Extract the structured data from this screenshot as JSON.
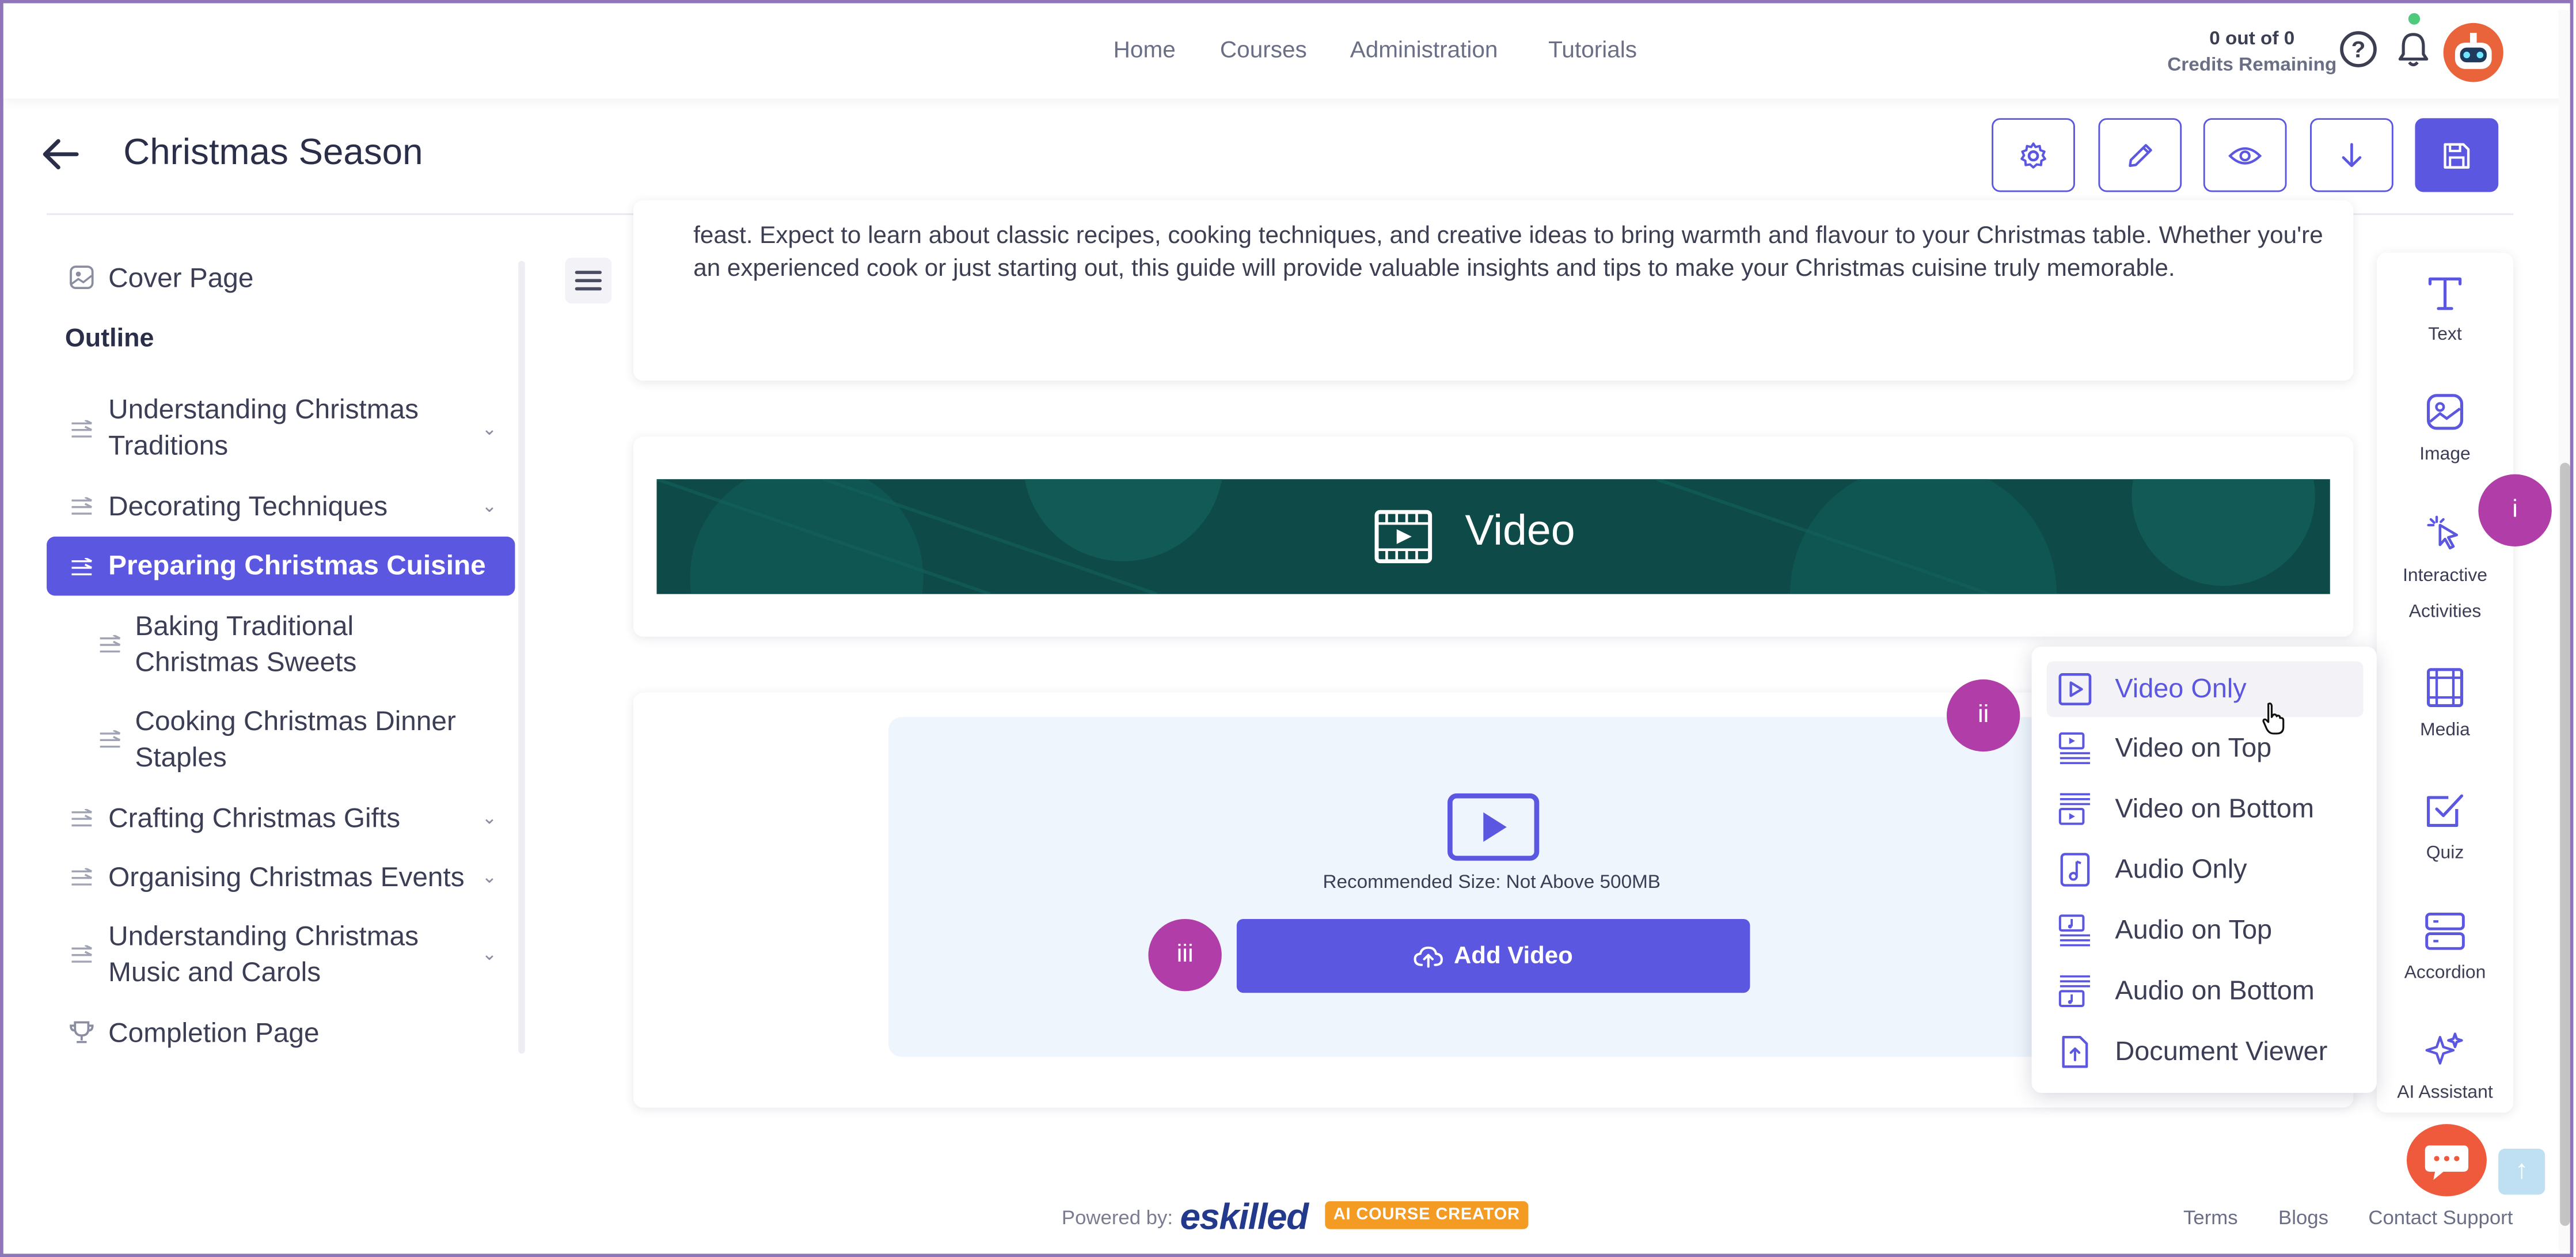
{
  "nav": {
    "links": [
      "Home",
      "Courses",
      "Administration",
      "Tutorials"
    ],
    "credits_value": "0 out of 0",
    "credits_label": "Credits Remaining"
  },
  "header": {
    "title": "Christmas Season"
  },
  "sidebar": {
    "cover_page": "Cover Page",
    "outline_heading": "Outline",
    "items": [
      {
        "label": "Understanding Christmas Traditions",
        "level": 0,
        "expandable": true
      },
      {
        "label": "Decorating Techniques",
        "level": 0,
        "expandable": true
      },
      {
        "label": "Preparing Christmas Cuisine",
        "level": 0,
        "expandable": false,
        "active": true
      },
      {
        "label": "Baking Traditional Christmas Sweets",
        "level": 1,
        "expandable": false
      },
      {
        "label": "Cooking Christmas Dinner Staples",
        "level": 1,
        "expandable": false
      },
      {
        "label": "Crafting Christmas Gifts",
        "level": 0,
        "expandable": true
      },
      {
        "label": "Organising Christmas Events",
        "level": 0,
        "expandable": true
      },
      {
        "label": "Understanding Christmas Music and Carols",
        "level": 0,
        "expandable": true
      }
    ],
    "completion_page": "Completion Page"
  },
  "content": {
    "intro_text": "feast. Expect to learn about classic recipes, cooking techniques, and creative ideas to bring warmth and flavour to your Christmas table. Whether you're an experienced cook or just starting out, this guide will provide valuable insights and tips to make your Christmas cuisine truly memorable.",
    "video_banner_title": "Video",
    "recommended_size": "Recommended Size: Not Above 500MB",
    "add_video_label": "Add Video"
  },
  "dropdown": {
    "items": [
      "Video Only",
      "Video on Top",
      "Video on Bottom",
      "Audio Only",
      "Audio on Top",
      "Audio on Bottom",
      "Document Viewer"
    ],
    "selected": "Video Only"
  },
  "tools": {
    "text": "Text",
    "image": "Image",
    "interactive": "Interactive Activities",
    "media": "Media",
    "quiz": "Quiz",
    "accordion": "Accordion",
    "ai": "AI Assistant"
  },
  "badges": {
    "one": "i",
    "two": "ii",
    "three": "iii"
  },
  "footer": {
    "powered_by": "Powered by:",
    "logo": "eskilled",
    "tag": "AI COURSE CREATOR",
    "links": [
      "Terms",
      "Blogs",
      "Contact Support"
    ]
  },
  "colors": {
    "accent": "#5b57e0",
    "badge": "#b13ea8",
    "banner": "#0e4b48",
    "danger": "#e5484d"
  }
}
